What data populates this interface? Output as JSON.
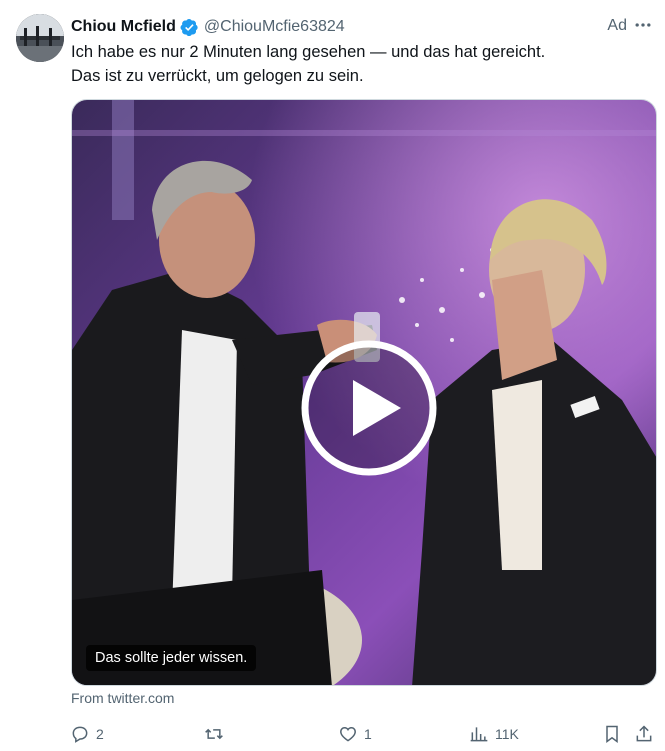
{
  "tweet": {
    "author_name": "Chiou Mcfield",
    "handle": "@ChiouMcfie63824",
    "ad_label": "Ad",
    "text_lines": [
      "Ich habe es nur 2 Minuten lang gesehen — und das hat gereicht.",
      "Das ist zu verrückt, um gelogen zu sein."
    ],
    "media_caption": "Das sollte jeder wissen.",
    "source": "From twitter.com"
  },
  "actions": {
    "replies": "2",
    "retweets": "",
    "likes": "1",
    "views": "11K"
  },
  "colors": {
    "text": "#0f1419",
    "secondary": "#536471",
    "verified_blue": "#1d9bf0",
    "border": "#cfd9de"
  },
  "icons": [
    "verified-badge-icon",
    "more-options-icon",
    "play-icon",
    "reply-icon",
    "retweet-icon",
    "like-icon",
    "views-icon",
    "bookmark-icon",
    "share-icon"
  ]
}
